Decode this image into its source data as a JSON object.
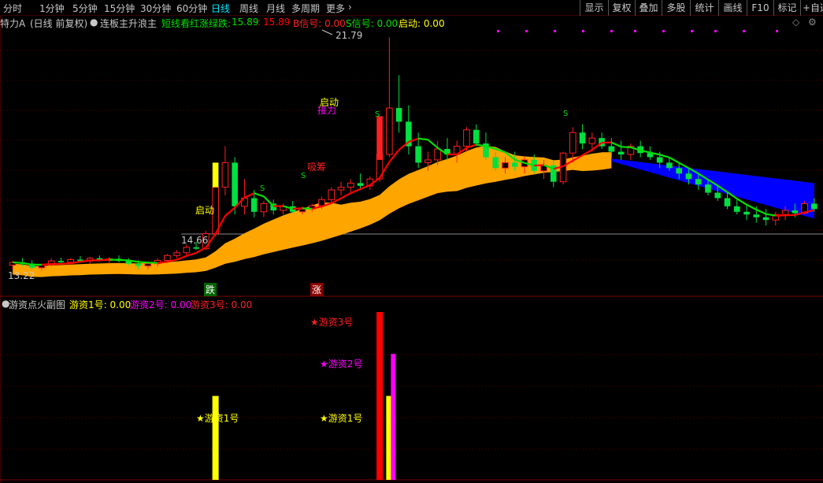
{
  "toolbar": {
    "periods": [
      "分时",
      "1分钟",
      "5分钟",
      "15分钟",
      "30分钟",
      "60分钟",
      "日线",
      "周线",
      "月线",
      "多周期",
      "更多"
    ],
    "active_period": "日线",
    "buttons": [
      "显示",
      "复权",
      "叠加",
      "多股",
      "统计",
      "画线",
      "F10",
      "标记",
      "+自选"
    ]
  },
  "main_header": {
    "stock_name": "特力A",
    "mode": "(日线 前复权)",
    "indicator_name": "连板主升浪主",
    "indicator_label": "短线看红涨绿跌:",
    "value_green": "15.89",
    "value_red": "15.89",
    "b_signal": "B信号: 0.00",
    "s_signal": "S信号: 0.00",
    "qidong": "启动: 0.00"
  },
  "price_labels": {
    "high": "21.79",
    "mid": "14.66",
    "low": "13.22"
  },
  "chart_annotations": {
    "qidong_1": "启动",
    "qidong_2": "启动",
    "jieli": "接力",
    "xigu": "吸筹",
    "s_mark": "S",
    "die": "跌",
    "zhang": "涨"
  },
  "sub_header": {
    "title": "游资点火副图",
    "y1": "游资1号: 0.00",
    "y2": "游资2号: 0.00",
    "y3": "游资3号: 0.00"
  },
  "colors": {
    "up": "#ff2020",
    "down": "#00e040",
    "ma_red": "#ff0000",
    "ma_green": "#00e000",
    "band_orange": "#ffa500",
    "band_blue": "#0000ff",
    "yellow": "#ffff00",
    "magenta": "#ff00ff",
    "red_bar": "#ff0000"
  },
  "chart_data": [
    {
      "type": "candlestick",
      "title": "连板主升浪主",
      "ylim": [
        13.0,
        22.0
      ],
      "price_labels": [
        21.79,
        14.66,
        13.22
      ],
      "candles": [
        [
          13.45,
          13.6,
          13.3,
          13.55
        ],
        [
          13.55,
          13.7,
          13.4,
          13.5
        ],
        [
          13.5,
          13.62,
          13.3,
          13.35
        ],
        [
          13.35,
          13.5,
          13.25,
          13.45
        ],
        [
          13.45,
          13.7,
          13.4,
          13.6
        ],
        [
          13.6,
          13.72,
          13.5,
          13.55
        ],
        [
          13.55,
          13.7,
          13.45,
          13.65
        ],
        [
          13.65,
          13.78,
          13.55,
          13.6
        ],
        [
          13.6,
          13.75,
          13.5,
          13.7
        ],
        [
          13.7,
          13.8,
          13.6,
          13.62
        ],
        [
          13.62,
          13.75,
          13.5,
          13.68
        ],
        [
          13.68,
          13.8,
          13.55,
          13.6
        ],
        [
          13.6,
          13.7,
          13.45,
          13.5
        ],
        [
          13.5,
          13.62,
          13.3,
          13.42
        ],
        [
          13.42,
          13.55,
          13.3,
          13.5
        ],
        [
          13.5,
          13.7,
          13.4,
          13.62
        ],
        [
          13.62,
          13.85,
          13.55,
          13.8
        ],
        [
          13.8,
          14.0,
          13.7,
          13.9
        ],
        [
          13.9,
          14.2,
          13.8,
          14.1
        ],
        [
          14.1,
          14.3,
          14.0,
          14.05
        ],
        [
          14.05,
          14.7,
          14.0,
          14.6
        ],
        [
          14.6,
          16.7,
          14.5,
          16.3
        ],
        [
          16.3,
          17.8,
          16.0,
          17.2
        ],
        [
          17.2,
          17.4,
          15.3,
          15.6
        ],
        [
          15.6,
          16.6,
          15.3,
          15.9
        ],
        [
          15.9,
          16.2,
          15.2,
          15.4
        ],
        [
          15.4,
          15.8,
          15.2,
          15.7
        ],
        [
          15.7,
          15.85,
          15.3,
          15.45
        ],
        [
          15.45,
          15.7,
          15.3,
          15.6
        ],
        [
          15.6,
          15.8,
          15.35,
          15.4
        ],
        [
          15.4,
          15.6,
          15.3,
          15.5
        ],
        [
          15.5,
          15.7,
          15.4,
          15.62
        ],
        [
          15.62,
          15.95,
          15.5,
          15.85
        ],
        [
          15.85,
          16.3,
          15.7,
          16.2
        ],
        [
          16.2,
          16.5,
          16.0,
          16.3
        ],
        [
          16.3,
          16.6,
          16.1,
          16.45
        ],
        [
          16.45,
          16.8,
          16.2,
          16.35
        ],
        [
          16.35,
          16.7,
          16.2,
          16.6
        ],
        [
          16.6,
          17.6,
          16.5,
          17.5
        ],
        [
          17.5,
          21.79,
          17.4,
          19.2
        ],
        [
          19.2,
          20.4,
          18.3,
          18.7
        ],
        [
          18.7,
          19.3,
          17.5,
          17.8
        ],
        [
          17.8,
          18.3,
          17.0,
          17.2
        ],
        [
          17.2,
          17.6,
          16.9,
          17.3
        ],
        [
          17.3,
          18.0,
          17.1,
          17.7
        ],
        [
          17.7,
          18.1,
          17.3,
          17.5
        ],
        [
          17.5,
          18.0,
          17.2,
          17.8
        ],
        [
          17.8,
          18.5,
          17.6,
          18.4
        ],
        [
          18.4,
          18.6,
          17.8,
          17.9
        ],
        [
          17.9,
          18.3,
          17.3,
          17.4
        ],
        [
          17.4,
          17.6,
          16.9,
          17.0
        ],
        [
          17.0,
          17.4,
          16.8,
          17.2
        ],
        [
          17.2,
          17.6,
          16.9,
          17.05
        ],
        [
          17.05,
          17.4,
          16.8,
          17.3
        ],
        [
          17.3,
          17.5,
          16.8,
          16.9
        ],
        [
          16.9,
          17.3,
          16.6,
          17.1
        ],
        [
          17.1,
          17.3,
          16.3,
          16.5
        ],
        [
          16.5,
          17.6,
          16.4,
          17.55
        ],
        [
          17.55,
          18.5,
          17.2,
          18.3
        ],
        [
          18.3,
          18.6,
          17.7,
          17.9
        ],
        [
          17.9,
          18.3,
          17.6,
          18.1
        ],
        [
          18.1,
          18.3,
          17.7,
          17.8
        ],
        [
          17.8,
          18.1,
          17.4,
          17.6
        ],
        [
          17.6,
          18.0,
          17.3,
          17.5
        ],
        [
          17.5,
          17.9,
          17.3,
          17.8
        ],
        [
          17.8,
          18.0,
          17.4,
          17.55
        ],
        [
          17.55,
          17.8,
          17.3,
          17.4
        ],
        [
          17.4,
          17.6,
          17.0,
          17.2
        ],
        [
          17.2,
          17.4,
          16.9,
          17.0
        ],
        [
          17.0,
          17.2,
          16.6,
          16.8
        ],
        [
          16.8,
          17.0,
          16.4,
          16.6
        ],
        [
          16.6,
          16.8,
          16.2,
          16.4
        ],
        [
          16.4,
          16.6,
          16.0,
          16.1
        ],
        [
          16.1,
          16.4,
          15.8,
          15.9
        ],
        [
          15.9,
          16.1,
          15.5,
          15.6
        ],
        [
          15.6,
          15.9,
          15.3,
          15.4
        ],
        [
          15.4,
          15.7,
          15.1,
          15.3
        ],
        [
          15.3,
          15.6,
          15.0,
          15.2
        ],
        [
          15.2,
          15.5,
          14.9,
          15.1
        ],
        [
          15.1,
          15.4,
          14.9,
          15.3
        ],
        [
          15.3,
          15.6,
          15.1,
          15.45
        ],
        [
          15.45,
          15.7,
          15.2,
          15.35
        ],
        [
          15.35,
          15.8,
          15.3,
          15.7
        ],
        [
          15.7,
          15.9,
          15.4,
          15.5
        ]
      ],
      "bands": [
        {
          "name": "orange",
          "from_value": 13.5,
          "to_value": 17.6
        },
        {
          "name": "blue",
          "from_value": 17.3,
          "to_value": 16.2
        }
      ]
    },
    {
      "type": "bar",
      "title": "游资点火副图",
      "series": [
        {
          "name": "游资1号",
          "color": "#ffff00",
          "values": [
            {
              "index": 21,
              "value": 1.0
            },
            {
              "index": 39,
              "value": 1.0
            }
          ]
        },
        {
          "name": "游资2号",
          "color": "#ff00ff",
          "values": [
            {
              "index": 39,
              "value": 1.5
            }
          ]
        },
        {
          "name": "游资3号",
          "color": "#ff0000",
          "values": [
            {
              "index": 38,
              "value": 2.0
            }
          ]
        }
      ]
    }
  ]
}
